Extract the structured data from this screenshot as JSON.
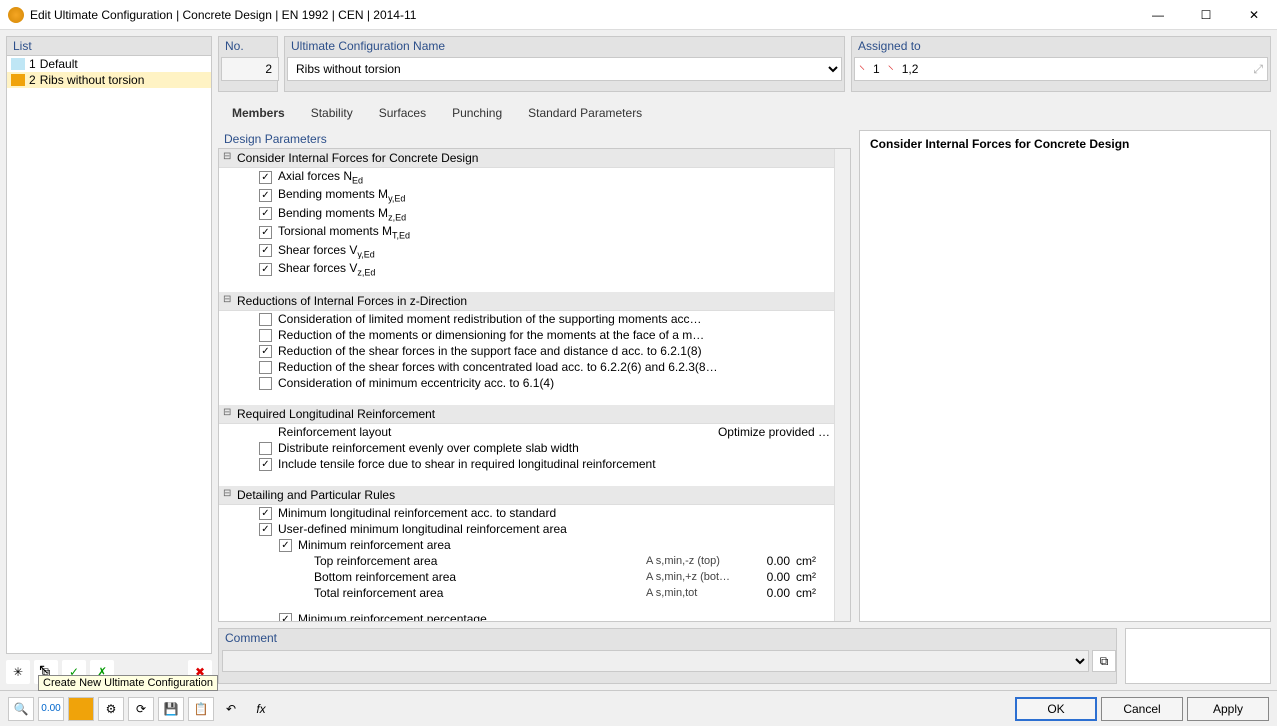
{
  "window": {
    "title": "Edit Ultimate Configuration | Concrete Design | EN 1992 | CEN | 2014-11"
  },
  "list": {
    "header": "List",
    "items": [
      {
        "no": "1",
        "name": "Default",
        "color": "#bfe6f5"
      },
      {
        "no": "2",
        "name": "Ribs without torsion",
        "color": "#f0a30a"
      }
    ]
  },
  "left_tools": {
    "new": "Create New",
    "copy": "Copy",
    "check_on": "Check All",
    "check_off": "Uncheck All",
    "delete": "Delete"
  },
  "tooltip": "Create New Ultimate Configuration",
  "fields": {
    "no_label": "No.",
    "no_value": "2",
    "name_label": "Ultimate Configuration Name",
    "name_value": "Ribs without torsion",
    "assigned_label": "Assigned to",
    "assigned_members": "1",
    "assigned_ribs": "1,2"
  },
  "tabs": [
    "Members",
    "Stability",
    "Surfaces",
    "Punching",
    "Standard Parameters"
  ],
  "params_header": "Design Parameters",
  "info_header": "Consider Internal Forces for Concrete Design",
  "groups": {
    "g1": {
      "title": "Consider Internal Forces for Concrete Design",
      "items": [
        {
          "c": true,
          "t": "Axial forces N",
          "sub": "Ed"
        },
        {
          "c": true,
          "t": "Bending moments M",
          "sub": "y,Ed"
        },
        {
          "c": true,
          "t": "Bending moments M",
          "sub": "z,Ed"
        },
        {
          "c": true,
          "t": "Torsional moments M",
          "sub": "T,Ed"
        },
        {
          "c": true,
          "t": "Shear forces V",
          "sub": "y,Ed"
        },
        {
          "c": true,
          "t": "Shear forces V",
          "sub": "z,Ed"
        }
      ]
    },
    "g2": {
      "title": "Reductions of Internal Forces in z-Direction",
      "items": [
        {
          "c": false,
          "t": "Consideration of limited moment redistribution of the supporting moments acc…"
        },
        {
          "c": false,
          "t": "Reduction of the moments or dimensioning for the moments at the face of a m…"
        },
        {
          "c": true,
          "t": "Reduction of the shear forces in the support face and distance d acc. to 6.2.1(8)"
        },
        {
          "c": false,
          "t": "Reduction of the shear forces with concentrated load acc. to 6.2.2(6) and 6.2.3(8…"
        },
        {
          "c": false,
          "t": "Consideration of minimum eccentricity acc. to 6.1(4)"
        }
      ]
    },
    "g3": {
      "title": "Required Longitudinal Reinforcement",
      "layout_label": "Reinforcement layout",
      "layout_value": "Optimize provided …",
      "items": [
        {
          "c": false,
          "t": "Distribute reinforcement evenly over complete slab width"
        },
        {
          "c": true,
          "t": "Include tensile force due to shear in required longitudinal reinforcement"
        }
      ]
    },
    "g4": {
      "title": "Detailing and Particular Rules",
      "items": [
        {
          "c": true,
          "t": "Minimum longitudinal reinforcement acc. to standard"
        },
        {
          "c": true,
          "t": "User-defined minimum longitudinal reinforcement area",
          "expandable": true
        }
      ],
      "subarea": {
        "head": {
          "c": true,
          "t": "Minimum reinforcement area"
        },
        "rows": [
          {
            "t": "Top reinforcement area",
            "sym": "A s,min,-z (top)",
            "v": "0.00",
            "u": "cm²"
          },
          {
            "t": "Bottom reinforcement area",
            "sym": "A s,min,+z (bot…",
            "v": "0.00",
            "u": "cm²"
          },
          {
            "t": "Total reinforcement area",
            "sym": "A s,min,tot",
            "v": "0.00",
            "u": "cm²"
          }
        ],
        "perc": {
          "c": true,
          "t": "Minimum reinforcement percentage"
        }
      }
    }
  },
  "comment_label": "Comment",
  "buttons": {
    "ok": "OK",
    "cancel": "Cancel",
    "apply": "Apply"
  }
}
